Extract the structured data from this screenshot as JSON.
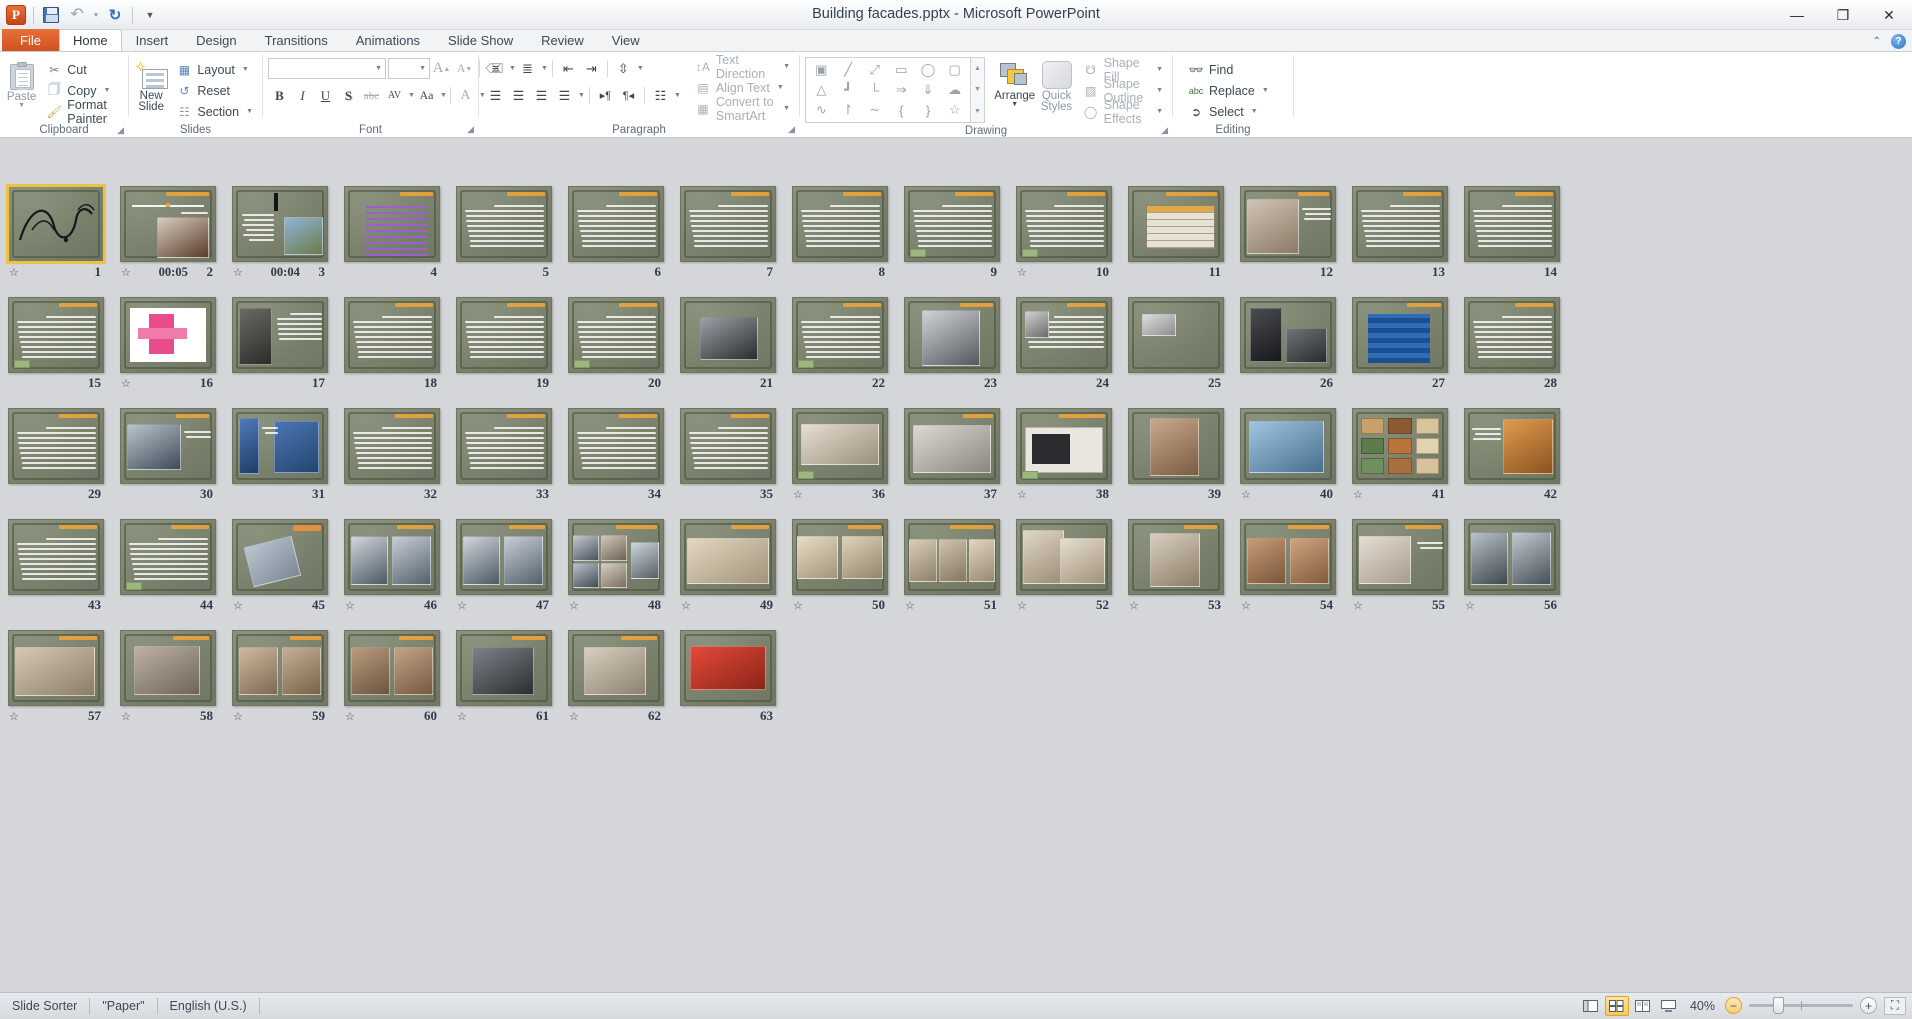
{
  "window": {
    "title": "Building facades.pptx  -  Microsoft PowerPoint",
    "app_logo": "P",
    "minimize": "—",
    "restore": "❐",
    "close": "✕"
  },
  "quick_access": {
    "save": "save-icon",
    "undo": "↶",
    "redo": "↻",
    "customize": "▾"
  },
  "tabs": [
    {
      "label": "File",
      "type": "file"
    },
    {
      "label": "Home",
      "type": "active"
    },
    {
      "label": "Insert",
      "type": "normal"
    },
    {
      "label": "Design",
      "type": "normal"
    },
    {
      "label": "Transitions",
      "type": "normal"
    },
    {
      "label": "Animations",
      "type": "normal"
    },
    {
      "label": "Slide Show",
      "type": "normal"
    },
    {
      "label": "Review",
      "type": "normal"
    },
    {
      "label": "View",
      "type": "normal"
    }
  ],
  "ribbon": {
    "minimize_ribbon": "⌃",
    "help": "?",
    "groups": [
      {
        "name": "Clipboard",
        "label": "Clipboard",
        "has_launcher": true
      },
      {
        "name": "Slides",
        "label": "Slides",
        "has_launcher": false
      },
      {
        "name": "Font",
        "label": "Font",
        "has_launcher": true
      },
      {
        "name": "Paragraph",
        "label": "Paragraph",
        "has_launcher": true
      },
      {
        "name": "Drawing",
        "label": "Drawing",
        "has_launcher": true
      },
      {
        "name": "Editing",
        "label": "Editing",
        "has_launcher": false
      }
    ],
    "clipboard": {
      "paste": "Paste",
      "cut": "Cut",
      "copy": "Copy",
      "format_painter": "Format Painter"
    },
    "slides": {
      "new_slide": "New\nSlide",
      "new_slide_line1": "New",
      "new_slide_line2": "Slide",
      "layout": "Layout",
      "reset": "Reset",
      "section": "Section"
    },
    "font": {
      "font_name": "",
      "font_size": "",
      "bold": "B",
      "italic": "I",
      "underline": "U",
      "shadow": "S",
      "strikethrough": "abc",
      "character_spacing": "AV",
      "change_case": "Aa",
      "font_color": "A",
      "increase_size": "A",
      "decrease_size": "A",
      "clear_formatting": "clear-formatting-icon"
    },
    "paragraph": {
      "bullets": "bullets-icon",
      "numbering": "numbering-icon",
      "decrease_indent": "decrease-indent-icon",
      "increase_indent": "increase-indent-icon",
      "line_spacing": "line-spacing-icon",
      "align_left": "align-left-icon",
      "center": "center-icon",
      "align_right": "align-right-icon",
      "justify": "justify-icon",
      "ltr": "▸¶",
      "rtl": "¶◂",
      "columns": "columns-icon",
      "text_direction": "Text Direction",
      "align_text": "Align Text",
      "convert_to_smartart": "Convert to SmartArt"
    },
    "drawing": {
      "shapes": [
        "textbox",
        "line",
        "arrow",
        "rectangle",
        "oval",
        "rounded-rect",
        "triangle",
        "elbow",
        "elbow-arrow",
        "right-arrow",
        "down-arrow",
        "cloud",
        "scribble",
        "curve",
        "wave",
        "left-brace",
        "right-brace",
        "star"
      ],
      "arrange": "Arrange",
      "quick_styles_line1": "Quick",
      "quick_styles_line2": "Styles",
      "shape_fill": "Shape Fill",
      "shape_outline": "Shape Outline",
      "shape_effects": "Shape Effects"
    },
    "editing": {
      "find": "Find",
      "replace": "Replace",
      "select": "Select"
    }
  },
  "sorter": {
    "selected_slide": 1,
    "columns": 14,
    "slides": [
      {
        "n": "1",
        "transition": true,
        "time": "",
        "kind": "calligraphy",
        "selected": true
      },
      {
        "n": "2",
        "transition": true,
        "time": "00:05",
        "kind": "title-image"
      },
      {
        "n": "3",
        "transition": true,
        "time": "00:04",
        "kind": "text-image-right"
      },
      {
        "n": "4",
        "transition": false,
        "time": "",
        "kind": "purple-lines"
      },
      {
        "n": "5",
        "transition": false,
        "time": "",
        "kind": "text"
      },
      {
        "n": "6",
        "transition": false,
        "time": "",
        "kind": "text"
      },
      {
        "n": "7",
        "transition": false,
        "time": "",
        "kind": "text"
      },
      {
        "n": "8",
        "transition": false,
        "time": "",
        "kind": "text"
      },
      {
        "n": "9",
        "transition": false,
        "time": "",
        "kind": "text-badge"
      },
      {
        "n": "10",
        "transition": true,
        "time": "",
        "kind": "text-badge"
      },
      {
        "n": "11",
        "transition": false,
        "time": "",
        "kind": "table"
      },
      {
        "n": "12",
        "transition": false,
        "time": "",
        "kind": "photo-building"
      },
      {
        "n": "13",
        "transition": false,
        "time": "",
        "kind": "text"
      },
      {
        "n": "14",
        "transition": false,
        "time": "",
        "kind": "text"
      },
      {
        "n": "15",
        "transition": false,
        "time": "",
        "kind": "text-badge"
      },
      {
        "n": "16",
        "transition": true,
        "time": "",
        "kind": "diagram-pink"
      },
      {
        "n": "17",
        "transition": false,
        "time": "",
        "kind": "photo-dark-left"
      },
      {
        "n": "18",
        "transition": false,
        "time": "",
        "kind": "text"
      },
      {
        "n": "19",
        "transition": false,
        "time": "",
        "kind": "text"
      },
      {
        "n": "20",
        "transition": false,
        "time": "",
        "kind": "text-badge"
      },
      {
        "n": "21",
        "transition": false,
        "time": "",
        "kind": "tools-photo"
      },
      {
        "n": "22",
        "transition": false,
        "time": "",
        "kind": "text-badge"
      },
      {
        "n": "23",
        "transition": false,
        "time": "",
        "kind": "photo-facade-bw"
      },
      {
        "n": "24",
        "transition": false,
        "time": "",
        "kind": "text-tool"
      },
      {
        "n": "25",
        "transition": false,
        "time": "",
        "kind": "tool-small"
      },
      {
        "n": "26",
        "transition": false,
        "time": "",
        "kind": "photo-dark-pair"
      },
      {
        "n": "27",
        "transition": false,
        "time": "",
        "kind": "blue-grid"
      },
      {
        "n": "28",
        "transition": false,
        "time": "",
        "kind": "text"
      },
      {
        "n": "29",
        "transition": false,
        "time": "",
        "kind": "text"
      },
      {
        "n": "30",
        "transition": false,
        "time": "",
        "kind": "photo-glass"
      },
      {
        "n": "31",
        "transition": false,
        "time": "",
        "kind": "photo-blue-tall"
      },
      {
        "n": "32",
        "transition": false,
        "time": "",
        "kind": "text"
      },
      {
        "n": "33",
        "transition": false,
        "time": "",
        "kind": "text"
      },
      {
        "n": "34",
        "transition": false,
        "time": "",
        "kind": "text"
      },
      {
        "n": "35",
        "transition": false,
        "time": "",
        "kind": "text"
      },
      {
        "n": "36",
        "transition": true,
        "time": "",
        "kind": "photo-panels"
      },
      {
        "n": "37",
        "transition": false,
        "time": "",
        "kind": "photo-drawing"
      },
      {
        "n": "38",
        "transition": true,
        "time": "",
        "kind": "photo-window"
      },
      {
        "n": "39",
        "transition": false,
        "time": "",
        "kind": "photo-brick"
      },
      {
        "n": "40",
        "transition": true,
        "time": "",
        "kind": "photo-blue-facade"
      },
      {
        "n": "41",
        "transition": true,
        "time": "",
        "kind": "swatches"
      },
      {
        "n": "42",
        "transition": false,
        "time": "",
        "kind": "photo-orange"
      },
      {
        "n": "43",
        "transition": false,
        "time": "",
        "kind": "text"
      },
      {
        "n": "44",
        "transition": false,
        "time": "",
        "kind": "text-badge"
      },
      {
        "n": "45",
        "transition": true,
        "time": "",
        "kind": "title-photo-tilt"
      },
      {
        "n": "46",
        "transition": true,
        "time": "",
        "kind": "photo-two-towers"
      },
      {
        "n": "47",
        "transition": true,
        "time": "",
        "kind": "photo-two-towers"
      },
      {
        "n": "48",
        "transition": true,
        "time": "",
        "kind": "photo-four"
      },
      {
        "n": "49",
        "transition": true,
        "time": "",
        "kind": "photo-beige"
      },
      {
        "n": "50",
        "transition": true,
        "time": "",
        "kind": "photo-wide-beige"
      },
      {
        "n": "51",
        "transition": true,
        "time": "",
        "kind": "photo-three"
      },
      {
        "n": "52",
        "transition": true,
        "time": "",
        "kind": "photo-stack"
      },
      {
        "n": "53",
        "transition": true,
        "time": "",
        "kind": "photo-apartment"
      },
      {
        "n": "54",
        "transition": true,
        "time": "",
        "kind": "photo-brick-pair"
      },
      {
        "n": "55",
        "transition": true,
        "time": "",
        "kind": "photo-balcony"
      },
      {
        "n": "56",
        "transition": true,
        "time": "",
        "kind": "photo-tower-pair"
      },
      {
        "n": "57",
        "transition": true,
        "time": "",
        "kind": "photo-corner-building"
      },
      {
        "n": "58",
        "transition": true,
        "time": "",
        "kind": "photo-old-building"
      },
      {
        "n": "59",
        "transition": true,
        "time": "",
        "kind": "photo-tan-pair"
      },
      {
        "n": "60",
        "transition": true,
        "time": "",
        "kind": "photo-brown-pair"
      },
      {
        "n": "61",
        "transition": true,
        "time": "",
        "kind": "photo-dark-bldg"
      },
      {
        "n": "62",
        "transition": true,
        "time": "",
        "kind": "photo-beige-bldg"
      },
      {
        "n": "63",
        "transition": false,
        "time": "",
        "kind": "photo-red-bus"
      }
    ]
  },
  "statusbar": {
    "view": "Slide Sorter",
    "theme": "\"Paper\"",
    "language": "English (U.S.)",
    "views": [
      {
        "name": "normal-view",
        "glyph": "normal"
      },
      {
        "name": "slide-sorter-view",
        "glyph": "sorter",
        "active": true
      },
      {
        "name": "reading-view",
        "glyph": "reading"
      },
      {
        "name": "slide-show-view",
        "glyph": "show"
      }
    ],
    "zoom_level": "40%",
    "zoom_out": "−",
    "zoom_in": "+",
    "fit_to_window": "fit-to-window-icon"
  },
  "colors": {
    "accent": "#f0c043",
    "file_tab": "#d2511f",
    "slide_bg": "#7e8672",
    "workspace": "#d4d6d9"
  }
}
